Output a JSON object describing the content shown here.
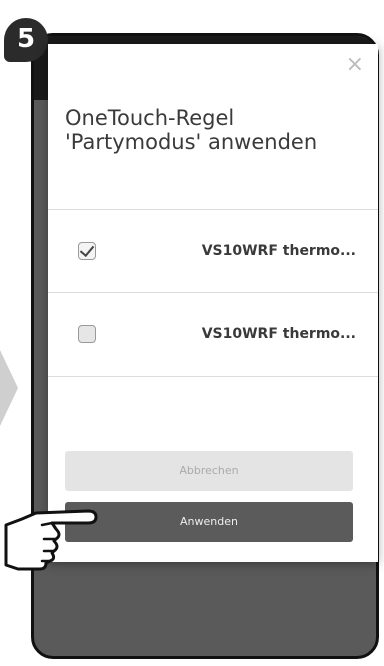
{
  "step": {
    "number": "5"
  },
  "dialog": {
    "close_symbol": "×",
    "title_line1": "OneTouch-Regel",
    "title_line2": "'Partymodus' anwenden",
    "devices": [
      {
        "label": "VS10WRF thermo...",
        "checked": true
      },
      {
        "label": "VS10WRF thermo...",
        "checked": false
      }
    ],
    "cancel_label": "Abbrechen",
    "apply_label": "Anwenden"
  },
  "icons": {
    "hand": "pointing-hand-icon",
    "close": "close-icon",
    "arrow": "arrow-right-icon"
  },
  "colors": {
    "apply_button": "#5b5b5b",
    "cancel_button": "#e4e4e4",
    "phone_body": "#5a5a5a"
  }
}
